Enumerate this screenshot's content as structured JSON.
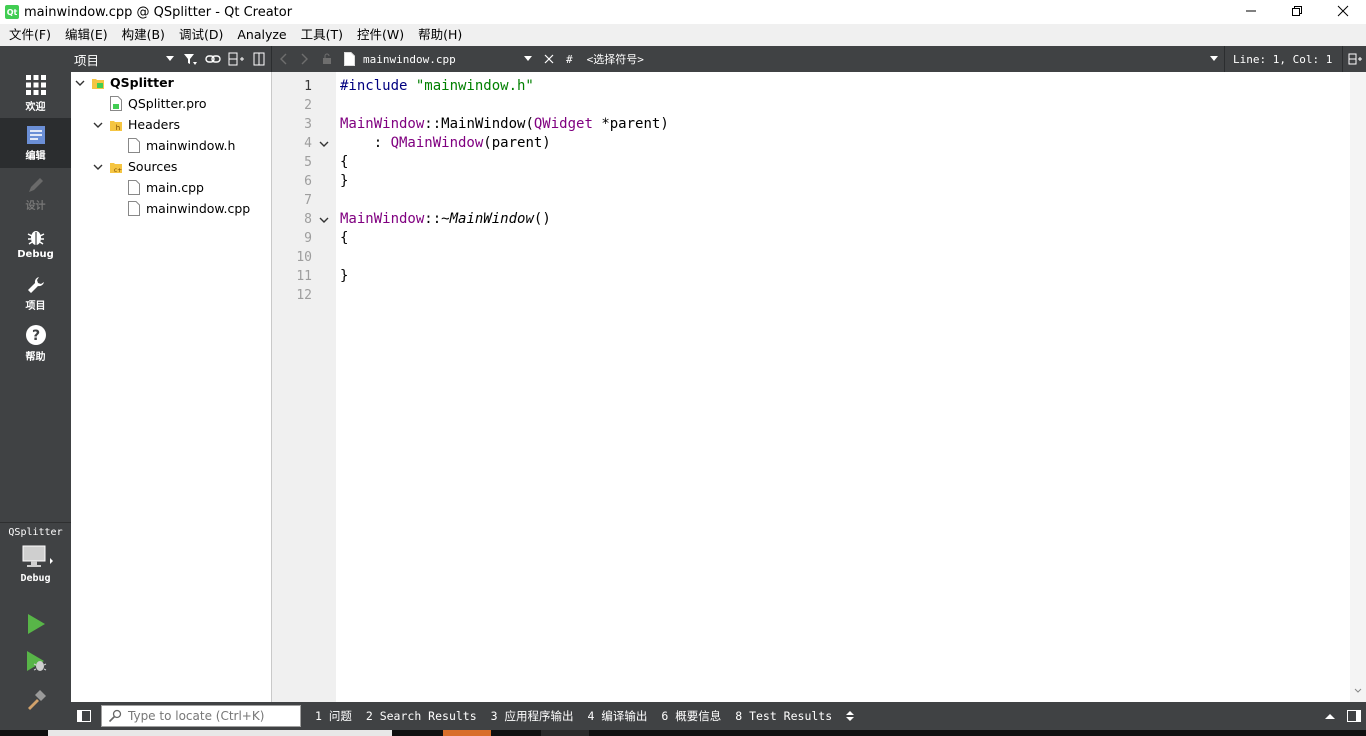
{
  "window": {
    "title": "mainwindow.cpp @ QSplitter - Qt Creator",
    "app_icon": "qt-icon",
    "app_icon_text": "Qt",
    "controls": [
      "minimize-icon",
      "restore-icon",
      "close-icon"
    ]
  },
  "menubar": {
    "items": [
      "文件(F)",
      "编辑(E)",
      "构建(B)",
      "调试(D)",
      "Analyze",
      "工具(T)",
      "控件(W)",
      "帮助(H)"
    ]
  },
  "modes": [
    {
      "label": "欢迎",
      "icon": "grid-icon",
      "state": "normal"
    },
    {
      "label": "编辑",
      "icon": "edit-document-icon",
      "state": "active"
    },
    {
      "label": "设计",
      "icon": "pencil-icon",
      "state": "disabled"
    },
    {
      "label": "Debug",
      "icon": "bug-icon",
      "state": "normal"
    },
    {
      "label": "项目",
      "icon": "wrench-icon",
      "state": "normal"
    },
    {
      "label": "帮助",
      "icon": "help-icon",
      "state": "normal"
    }
  ],
  "kit": {
    "project": "QSplitter",
    "build_config": "Debug",
    "icons": [
      "monitor-icon",
      "run-icon",
      "debug-run-icon",
      "build-hammer-icon"
    ]
  },
  "project_panel": {
    "view_selector": "项目",
    "toolbar_icons": [
      "filter-icon",
      "link-icon",
      "split-add-icon",
      "close-panel-icon"
    ],
    "tree": [
      {
        "label": "QSplitter",
        "level": 0,
        "expanded": true,
        "icon": "project-folder-icon",
        "bold": true
      },
      {
        "label": "QSplitter.pro",
        "level": 1,
        "icon": "pro-file-icon"
      },
      {
        "label": "Headers",
        "level": 1,
        "expanded": true,
        "icon": "headers-folder-icon"
      },
      {
        "label": "mainwindow.h",
        "level": 2,
        "icon": "file-icon"
      },
      {
        "label": "Sources",
        "level": 1,
        "expanded": true,
        "icon": "sources-folder-icon"
      },
      {
        "label": "main.cpp",
        "level": 2,
        "icon": "file-icon"
      },
      {
        "label": "mainwindow.cpp",
        "level": 2,
        "icon": "file-icon"
      }
    ]
  },
  "editor": {
    "document": "mainwindow.cpp",
    "symbol_hash": "#",
    "symbol_placeholder": "<选择符号>",
    "cursor_position": "Line: 1, Col: 1",
    "current_line": 1,
    "line_numbers": [
      "1",
      "2",
      "3",
      "4",
      "5",
      "6",
      "7",
      "8",
      "9",
      "10",
      "11",
      "12"
    ],
    "foldable_lines": [
      4,
      8
    ],
    "code": [
      [
        {
          "t": "#include ",
          "c": "kw"
        },
        {
          "t": "\"mainwindow.h\"",
          "c": "str"
        }
      ],
      [],
      [
        {
          "t": "MainWindow",
          "c": "cls"
        },
        {
          "t": "::MainWindow(",
          "c": "fn"
        },
        {
          "t": "QWidget",
          "c": "cls"
        },
        {
          "t": " *parent)",
          "c": "fn"
        }
      ],
      [
        {
          "t": "    : ",
          "c": "fn"
        },
        {
          "t": "QMainWindow",
          "c": "cls"
        },
        {
          "t": "(parent)",
          "c": "fn"
        }
      ],
      [
        {
          "t": "{",
          "c": "fn"
        }
      ],
      [
        {
          "t": "}",
          "c": "fn"
        }
      ],
      [],
      [
        {
          "t": "MainWindow",
          "c": "cls"
        },
        {
          "t": "::~",
          "c": "fn"
        },
        {
          "t": "MainWindow",
          "c": "it"
        },
        {
          "t": "()",
          "c": "fn"
        }
      ],
      [
        {
          "t": "{",
          "c": "fn"
        }
      ],
      [],
      [
        {
          "t": "}",
          "c": "fn"
        }
      ],
      []
    ]
  },
  "statusbar": {
    "locator_placeholder": "Type to locate (Ctrl+K)",
    "output_tabs": [
      "1  问题",
      "2  Search Results",
      "3  应用程序输出",
      "4  编译输出",
      "6  概要信息",
      "8  Test Results"
    ]
  },
  "colors": {
    "dark_panel": "#404244",
    "active_mode": "#2b2d2f",
    "keyword": "#000080",
    "string": "#008000",
    "class": "#800080",
    "run_green": "#58b548"
  }
}
